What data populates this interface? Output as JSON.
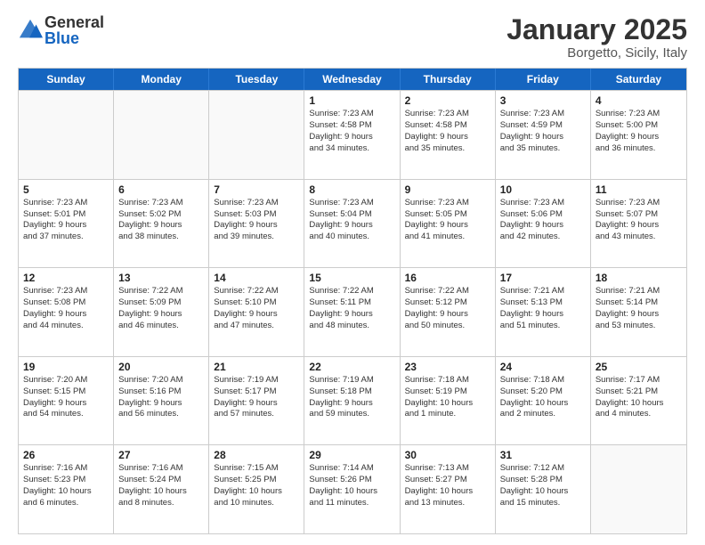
{
  "header": {
    "logo_general": "General",
    "logo_blue": "Blue",
    "title": "January 2025",
    "subtitle": "Borgetto, Sicily, Italy"
  },
  "weekdays": [
    "Sunday",
    "Monday",
    "Tuesday",
    "Wednesday",
    "Thursday",
    "Friday",
    "Saturday"
  ],
  "weeks": [
    [
      {
        "day": "",
        "empty": true
      },
      {
        "day": "",
        "empty": true
      },
      {
        "day": "",
        "empty": true
      },
      {
        "day": "1",
        "lines": [
          "Sunrise: 7:23 AM",
          "Sunset: 4:58 PM",
          "Daylight: 9 hours",
          "and 34 minutes."
        ]
      },
      {
        "day": "2",
        "lines": [
          "Sunrise: 7:23 AM",
          "Sunset: 4:58 PM",
          "Daylight: 9 hours",
          "and 35 minutes."
        ]
      },
      {
        "day": "3",
        "lines": [
          "Sunrise: 7:23 AM",
          "Sunset: 4:59 PM",
          "Daylight: 9 hours",
          "and 35 minutes."
        ]
      },
      {
        "day": "4",
        "lines": [
          "Sunrise: 7:23 AM",
          "Sunset: 5:00 PM",
          "Daylight: 9 hours",
          "and 36 minutes."
        ]
      }
    ],
    [
      {
        "day": "5",
        "lines": [
          "Sunrise: 7:23 AM",
          "Sunset: 5:01 PM",
          "Daylight: 9 hours",
          "and 37 minutes."
        ]
      },
      {
        "day": "6",
        "lines": [
          "Sunrise: 7:23 AM",
          "Sunset: 5:02 PM",
          "Daylight: 9 hours",
          "and 38 minutes."
        ]
      },
      {
        "day": "7",
        "lines": [
          "Sunrise: 7:23 AM",
          "Sunset: 5:03 PM",
          "Daylight: 9 hours",
          "and 39 minutes."
        ]
      },
      {
        "day": "8",
        "lines": [
          "Sunrise: 7:23 AM",
          "Sunset: 5:04 PM",
          "Daylight: 9 hours",
          "and 40 minutes."
        ]
      },
      {
        "day": "9",
        "lines": [
          "Sunrise: 7:23 AM",
          "Sunset: 5:05 PM",
          "Daylight: 9 hours",
          "and 41 minutes."
        ]
      },
      {
        "day": "10",
        "lines": [
          "Sunrise: 7:23 AM",
          "Sunset: 5:06 PM",
          "Daylight: 9 hours",
          "and 42 minutes."
        ]
      },
      {
        "day": "11",
        "lines": [
          "Sunrise: 7:23 AM",
          "Sunset: 5:07 PM",
          "Daylight: 9 hours",
          "and 43 minutes."
        ]
      }
    ],
    [
      {
        "day": "12",
        "lines": [
          "Sunrise: 7:23 AM",
          "Sunset: 5:08 PM",
          "Daylight: 9 hours",
          "and 44 minutes."
        ]
      },
      {
        "day": "13",
        "lines": [
          "Sunrise: 7:22 AM",
          "Sunset: 5:09 PM",
          "Daylight: 9 hours",
          "and 46 minutes."
        ]
      },
      {
        "day": "14",
        "lines": [
          "Sunrise: 7:22 AM",
          "Sunset: 5:10 PM",
          "Daylight: 9 hours",
          "and 47 minutes."
        ]
      },
      {
        "day": "15",
        "lines": [
          "Sunrise: 7:22 AM",
          "Sunset: 5:11 PM",
          "Daylight: 9 hours",
          "and 48 minutes."
        ]
      },
      {
        "day": "16",
        "lines": [
          "Sunrise: 7:22 AM",
          "Sunset: 5:12 PM",
          "Daylight: 9 hours",
          "and 50 minutes."
        ]
      },
      {
        "day": "17",
        "lines": [
          "Sunrise: 7:21 AM",
          "Sunset: 5:13 PM",
          "Daylight: 9 hours",
          "and 51 minutes."
        ]
      },
      {
        "day": "18",
        "lines": [
          "Sunrise: 7:21 AM",
          "Sunset: 5:14 PM",
          "Daylight: 9 hours",
          "and 53 minutes."
        ]
      }
    ],
    [
      {
        "day": "19",
        "lines": [
          "Sunrise: 7:20 AM",
          "Sunset: 5:15 PM",
          "Daylight: 9 hours",
          "and 54 minutes."
        ]
      },
      {
        "day": "20",
        "lines": [
          "Sunrise: 7:20 AM",
          "Sunset: 5:16 PM",
          "Daylight: 9 hours",
          "and 56 minutes."
        ]
      },
      {
        "day": "21",
        "lines": [
          "Sunrise: 7:19 AM",
          "Sunset: 5:17 PM",
          "Daylight: 9 hours",
          "and 57 minutes."
        ]
      },
      {
        "day": "22",
        "lines": [
          "Sunrise: 7:19 AM",
          "Sunset: 5:18 PM",
          "Daylight: 9 hours",
          "and 59 minutes."
        ]
      },
      {
        "day": "23",
        "lines": [
          "Sunrise: 7:18 AM",
          "Sunset: 5:19 PM",
          "Daylight: 10 hours",
          "and 1 minute."
        ]
      },
      {
        "day": "24",
        "lines": [
          "Sunrise: 7:18 AM",
          "Sunset: 5:20 PM",
          "Daylight: 10 hours",
          "and 2 minutes."
        ]
      },
      {
        "day": "25",
        "lines": [
          "Sunrise: 7:17 AM",
          "Sunset: 5:21 PM",
          "Daylight: 10 hours",
          "and 4 minutes."
        ]
      }
    ],
    [
      {
        "day": "26",
        "lines": [
          "Sunrise: 7:16 AM",
          "Sunset: 5:23 PM",
          "Daylight: 10 hours",
          "and 6 minutes."
        ]
      },
      {
        "day": "27",
        "lines": [
          "Sunrise: 7:16 AM",
          "Sunset: 5:24 PM",
          "Daylight: 10 hours",
          "and 8 minutes."
        ]
      },
      {
        "day": "28",
        "lines": [
          "Sunrise: 7:15 AM",
          "Sunset: 5:25 PM",
          "Daylight: 10 hours",
          "and 10 minutes."
        ]
      },
      {
        "day": "29",
        "lines": [
          "Sunrise: 7:14 AM",
          "Sunset: 5:26 PM",
          "Daylight: 10 hours",
          "and 11 minutes."
        ]
      },
      {
        "day": "30",
        "lines": [
          "Sunrise: 7:13 AM",
          "Sunset: 5:27 PM",
          "Daylight: 10 hours",
          "and 13 minutes."
        ]
      },
      {
        "day": "31",
        "lines": [
          "Sunrise: 7:12 AM",
          "Sunset: 5:28 PM",
          "Daylight: 10 hours",
          "and 15 minutes."
        ]
      },
      {
        "day": "",
        "empty": true
      }
    ]
  ]
}
